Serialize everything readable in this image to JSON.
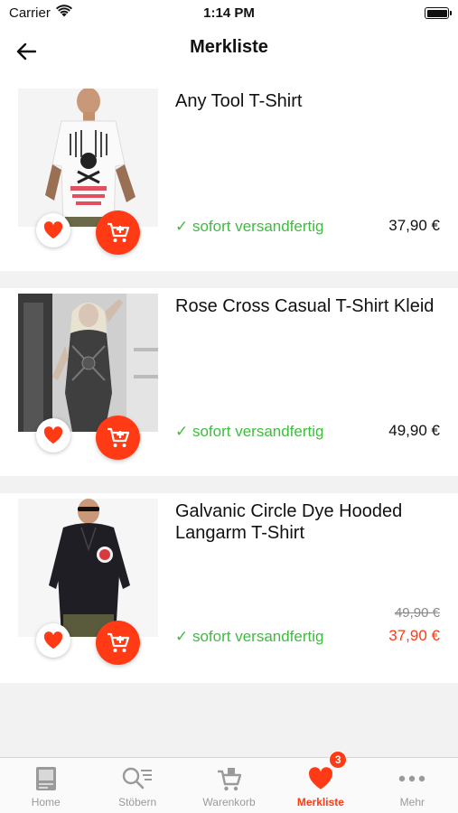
{
  "status_bar": {
    "carrier": "Carrier",
    "time": "1:14 PM"
  },
  "header": {
    "title": "Merkliste"
  },
  "items": [
    {
      "name": "Any Tool T-Shirt",
      "stock": "✓ sofort versandfertig",
      "price": "37,90 €"
    },
    {
      "name": "Rose Cross Casual T-Shirt Kleid",
      "stock": "✓ sofort versandfertig",
      "price": "49,90 €"
    },
    {
      "name": "Galvanic Circle Dye Hooded Langarm T-Shirt",
      "stock": "✓ sofort versandfertig",
      "old_price": "49,90 €",
      "price": "37,90 €"
    }
  ],
  "tabs": [
    {
      "label": "Home",
      "icon": "home-icon"
    },
    {
      "label": "Stöbern",
      "icon": "search-list-icon"
    },
    {
      "label": "Warenkorb",
      "icon": "cart-icon"
    },
    {
      "label": "Merkliste",
      "icon": "heart-icon",
      "badge": "3",
      "active": true
    },
    {
      "label": "Mehr",
      "icon": "more-icon"
    }
  ],
  "colors": {
    "accent": "#ff3a14",
    "stock_green": "#3cbe3c",
    "tab_inactive": "#9a9a9a"
  }
}
